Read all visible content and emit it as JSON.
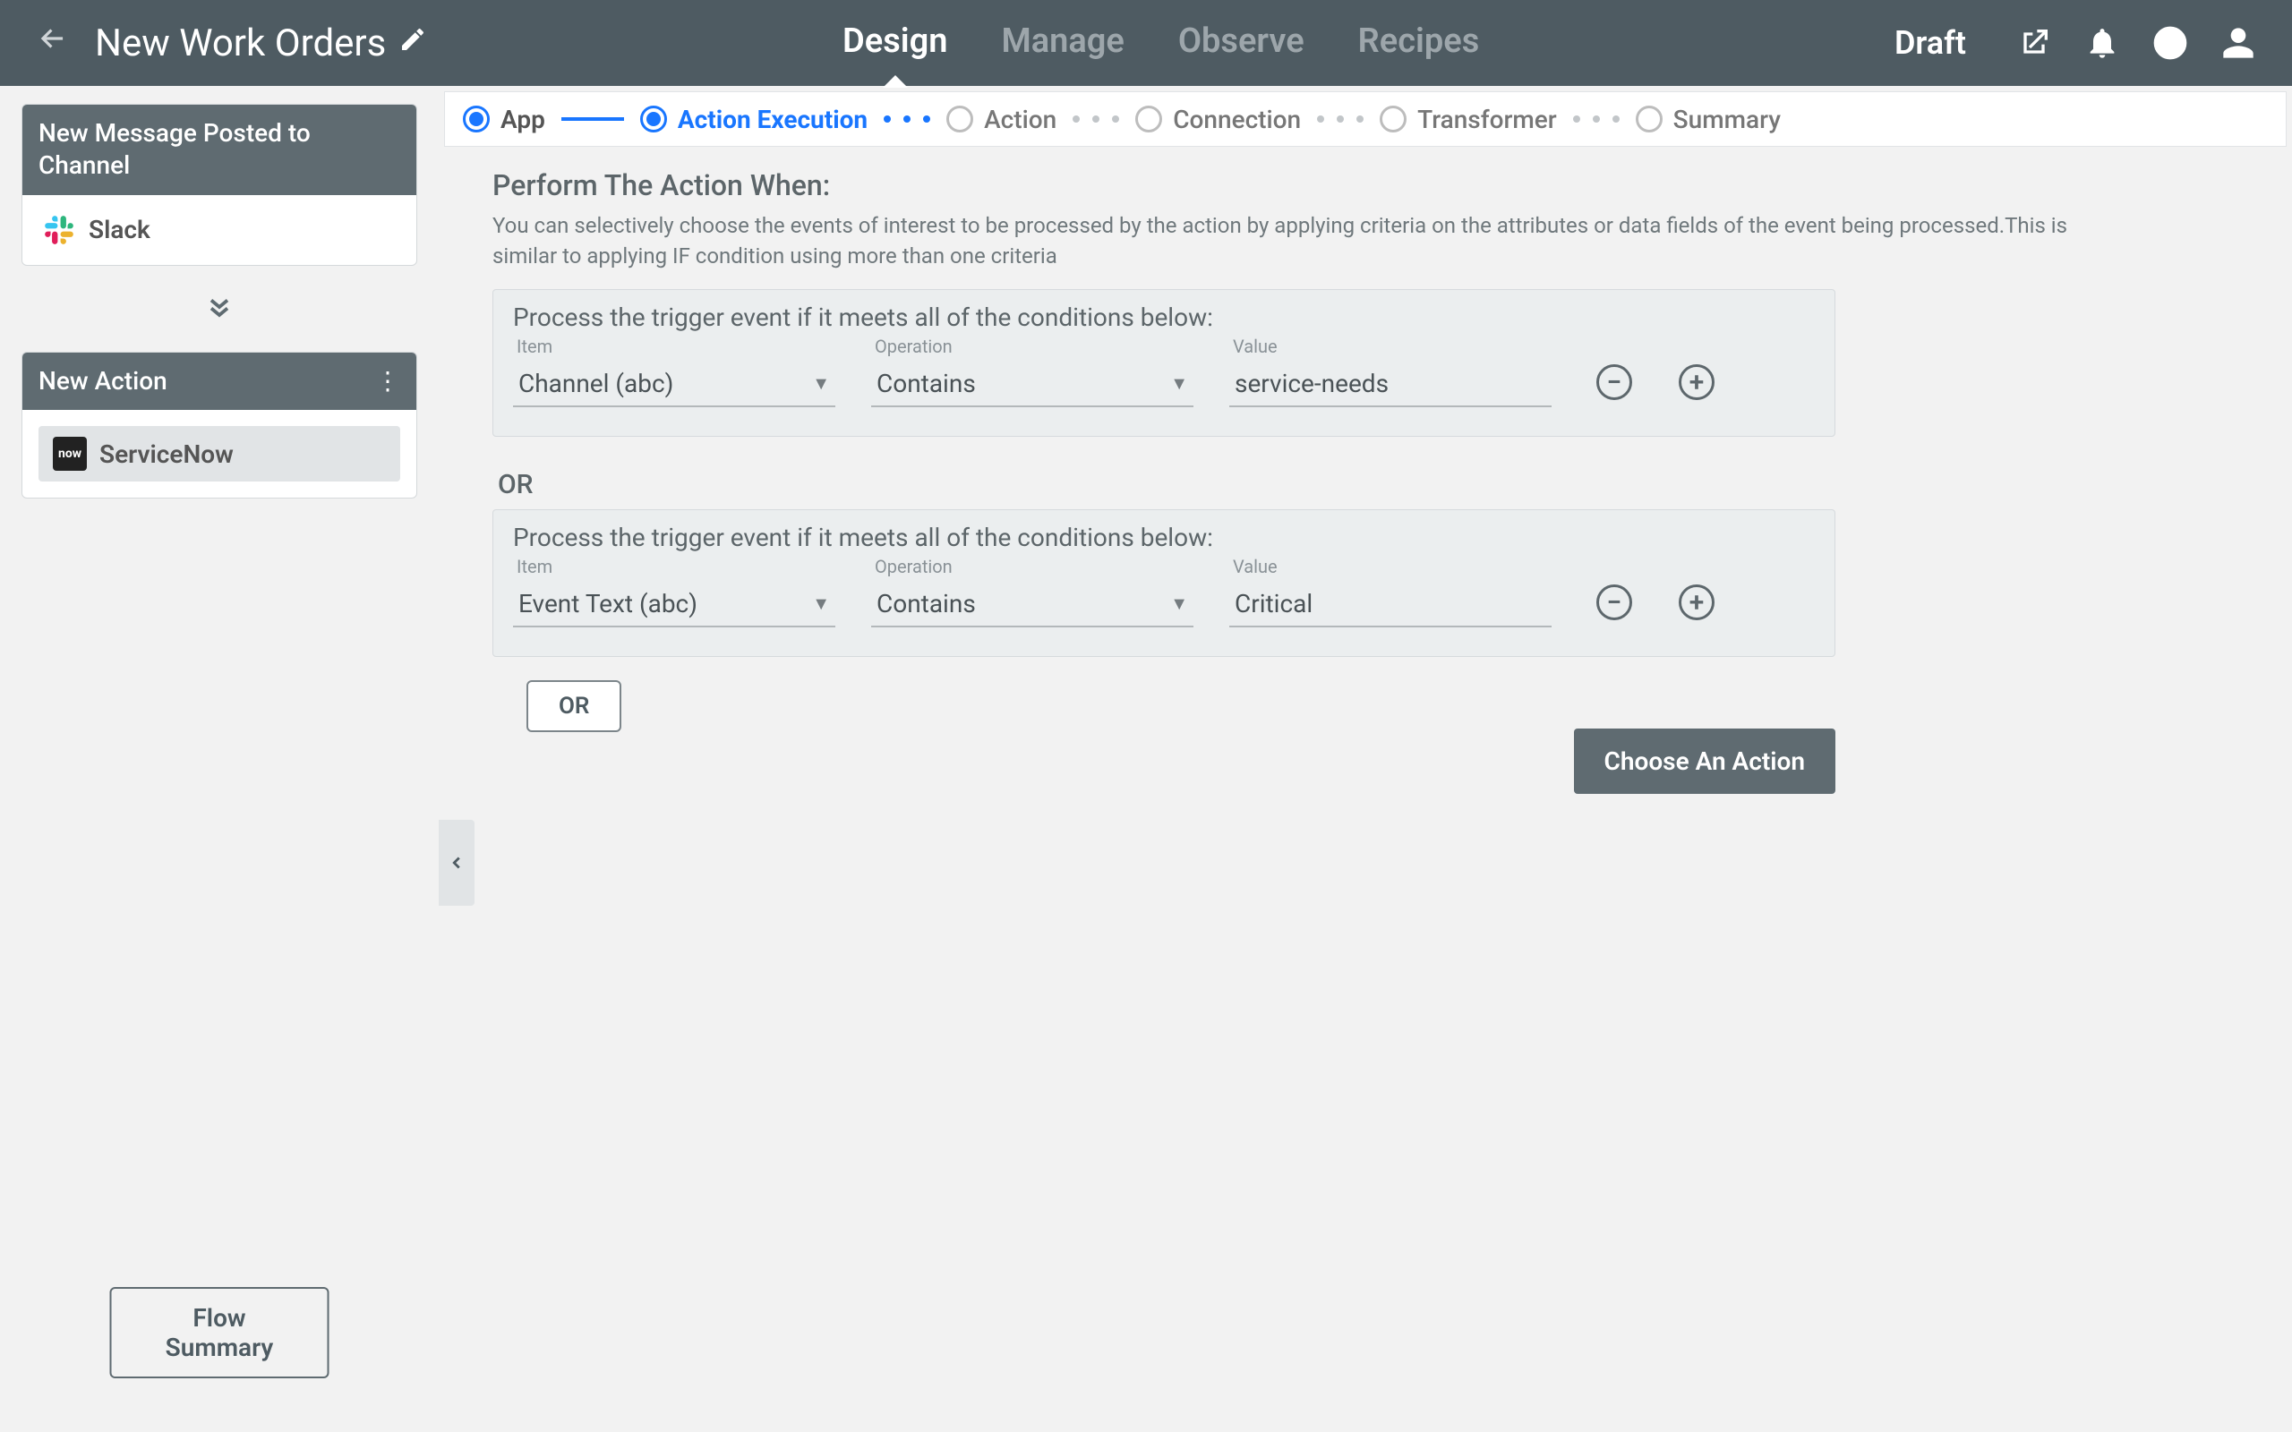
{
  "header": {
    "title": "New Work Orders",
    "status": "Draft",
    "tabs": [
      "Design",
      "Manage",
      "Observe",
      "Recipes"
    ],
    "active_tab": 0
  },
  "sidebar": {
    "trigger_card": {
      "title": "New Message Posted to Channel",
      "app": "Slack"
    },
    "action_card": {
      "title": "New Action",
      "app": "ServiceNow"
    },
    "flow_summary_btn": "Flow Summary"
  },
  "stepper": {
    "steps": [
      "App",
      "Action Execution",
      "Action",
      "Connection",
      "Transformer",
      "Summary"
    ],
    "active": 1
  },
  "content": {
    "title": "Perform The Action When:",
    "desc": "You can selectively choose the events of interest to be processed by the action by applying criteria on the attributes or data fields of the event being processed.This is similar to applying IF condition using more than one criteria",
    "block_title": "Process the trigger event if it meets all of the conditions below:",
    "labels": {
      "item": "Item",
      "operation": "Operation",
      "value": "Value"
    },
    "groups": [
      {
        "rows": [
          {
            "item": "Channel (abc)",
            "op": "Contains",
            "value": "service-needs"
          }
        ]
      },
      {
        "rows": [
          {
            "item": "Event Text (abc)",
            "op": "Contains",
            "value": "Critical"
          }
        ]
      }
    ],
    "or_label": "OR",
    "or_btn": "OR",
    "choose_action_btn": "Choose An Action"
  }
}
